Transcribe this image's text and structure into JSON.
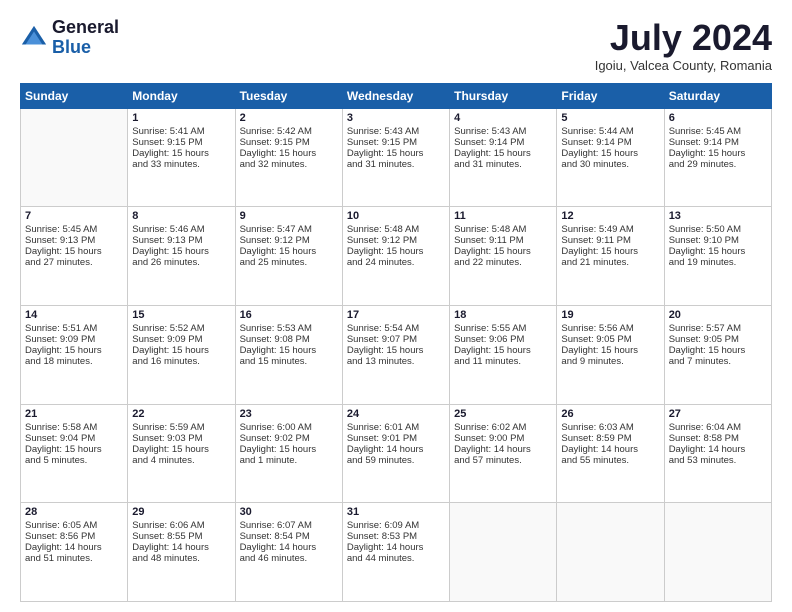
{
  "logo": {
    "general": "General",
    "blue": "Blue"
  },
  "title": "July 2024",
  "location": "Igoiu, Valcea County, Romania",
  "days": [
    "Sunday",
    "Monday",
    "Tuesday",
    "Wednesday",
    "Thursday",
    "Friday",
    "Saturday"
  ],
  "weeks": [
    [
      {
        "day": "",
        "content": ""
      },
      {
        "day": "1",
        "content": "Sunrise: 5:41 AM\nSunset: 9:15 PM\nDaylight: 15 hours\nand 33 minutes."
      },
      {
        "day": "2",
        "content": "Sunrise: 5:42 AM\nSunset: 9:15 PM\nDaylight: 15 hours\nand 32 minutes."
      },
      {
        "day": "3",
        "content": "Sunrise: 5:43 AM\nSunset: 9:15 PM\nDaylight: 15 hours\nand 31 minutes."
      },
      {
        "day": "4",
        "content": "Sunrise: 5:43 AM\nSunset: 9:14 PM\nDaylight: 15 hours\nand 31 minutes."
      },
      {
        "day": "5",
        "content": "Sunrise: 5:44 AM\nSunset: 9:14 PM\nDaylight: 15 hours\nand 30 minutes."
      },
      {
        "day": "6",
        "content": "Sunrise: 5:45 AM\nSunset: 9:14 PM\nDaylight: 15 hours\nand 29 minutes."
      }
    ],
    [
      {
        "day": "7",
        "content": "Sunrise: 5:45 AM\nSunset: 9:13 PM\nDaylight: 15 hours\nand 27 minutes."
      },
      {
        "day": "8",
        "content": "Sunrise: 5:46 AM\nSunset: 9:13 PM\nDaylight: 15 hours\nand 26 minutes."
      },
      {
        "day": "9",
        "content": "Sunrise: 5:47 AM\nSunset: 9:12 PM\nDaylight: 15 hours\nand 25 minutes."
      },
      {
        "day": "10",
        "content": "Sunrise: 5:48 AM\nSunset: 9:12 PM\nDaylight: 15 hours\nand 24 minutes."
      },
      {
        "day": "11",
        "content": "Sunrise: 5:48 AM\nSunset: 9:11 PM\nDaylight: 15 hours\nand 22 minutes."
      },
      {
        "day": "12",
        "content": "Sunrise: 5:49 AM\nSunset: 9:11 PM\nDaylight: 15 hours\nand 21 minutes."
      },
      {
        "day": "13",
        "content": "Sunrise: 5:50 AM\nSunset: 9:10 PM\nDaylight: 15 hours\nand 19 minutes."
      }
    ],
    [
      {
        "day": "14",
        "content": "Sunrise: 5:51 AM\nSunset: 9:09 PM\nDaylight: 15 hours\nand 18 minutes."
      },
      {
        "day": "15",
        "content": "Sunrise: 5:52 AM\nSunset: 9:09 PM\nDaylight: 15 hours\nand 16 minutes."
      },
      {
        "day": "16",
        "content": "Sunrise: 5:53 AM\nSunset: 9:08 PM\nDaylight: 15 hours\nand 15 minutes."
      },
      {
        "day": "17",
        "content": "Sunrise: 5:54 AM\nSunset: 9:07 PM\nDaylight: 15 hours\nand 13 minutes."
      },
      {
        "day": "18",
        "content": "Sunrise: 5:55 AM\nSunset: 9:06 PM\nDaylight: 15 hours\nand 11 minutes."
      },
      {
        "day": "19",
        "content": "Sunrise: 5:56 AM\nSunset: 9:05 PM\nDaylight: 15 hours\nand 9 minutes."
      },
      {
        "day": "20",
        "content": "Sunrise: 5:57 AM\nSunset: 9:05 PM\nDaylight: 15 hours\nand 7 minutes."
      }
    ],
    [
      {
        "day": "21",
        "content": "Sunrise: 5:58 AM\nSunset: 9:04 PM\nDaylight: 15 hours\nand 5 minutes."
      },
      {
        "day": "22",
        "content": "Sunrise: 5:59 AM\nSunset: 9:03 PM\nDaylight: 15 hours\nand 4 minutes."
      },
      {
        "day": "23",
        "content": "Sunrise: 6:00 AM\nSunset: 9:02 PM\nDaylight: 15 hours\nand 1 minute."
      },
      {
        "day": "24",
        "content": "Sunrise: 6:01 AM\nSunset: 9:01 PM\nDaylight: 14 hours\nand 59 minutes."
      },
      {
        "day": "25",
        "content": "Sunrise: 6:02 AM\nSunset: 9:00 PM\nDaylight: 14 hours\nand 57 minutes."
      },
      {
        "day": "26",
        "content": "Sunrise: 6:03 AM\nSunset: 8:59 PM\nDaylight: 14 hours\nand 55 minutes."
      },
      {
        "day": "27",
        "content": "Sunrise: 6:04 AM\nSunset: 8:58 PM\nDaylight: 14 hours\nand 53 minutes."
      }
    ],
    [
      {
        "day": "28",
        "content": "Sunrise: 6:05 AM\nSunset: 8:56 PM\nDaylight: 14 hours\nand 51 minutes."
      },
      {
        "day": "29",
        "content": "Sunrise: 6:06 AM\nSunset: 8:55 PM\nDaylight: 14 hours\nand 48 minutes."
      },
      {
        "day": "30",
        "content": "Sunrise: 6:07 AM\nSunset: 8:54 PM\nDaylight: 14 hours\nand 46 minutes."
      },
      {
        "day": "31",
        "content": "Sunrise: 6:09 AM\nSunset: 8:53 PM\nDaylight: 14 hours\nand 44 minutes."
      },
      {
        "day": "",
        "content": ""
      },
      {
        "day": "",
        "content": ""
      },
      {
        "day": "",
        "content": ""
      }
    ]
  ]
}
